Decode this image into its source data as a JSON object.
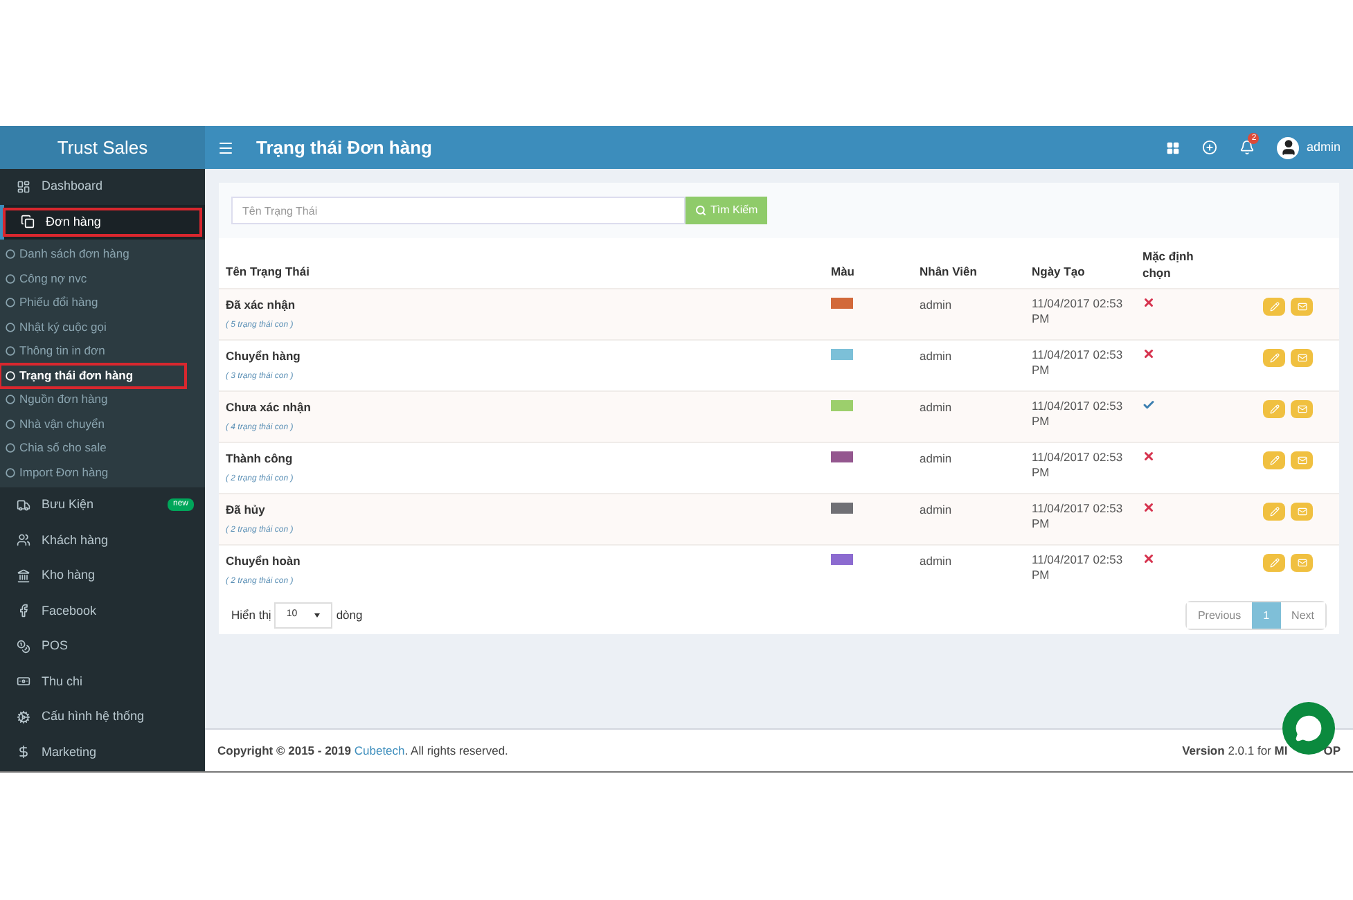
{
  "sidebar": {
    "brand": "Trust Sales",
    "items": [
      {
        "label": "Dashboard",
        "selected": false,
        "highlighted": false
      },
      {
        "label": "Đơn hàng",
        "selected": true,
        "highlighted": true,
        "expanded": true,
        "children": [
          {
            "label": "Danh sách đơn hàng",
            "selected": false,
            "highlighted": false
          },
          {
            "label": "Công nợ nvc",
            "selected": false,
            "highlighted": false
          },
          {
            "label": "Phiếu đổi hàng",
            "selected": false,
            "highlighted": false
          },
          {
            "label": "Nhật ký cuộc gọi",
            "selected": false,
            "highlighted": false
          },
          {
            "label": "Thông tin in đơn",
            "selected": false,
            "highlighted": false
          },
          {
            "label": "Trạng thái đơn hàng",
            "selected": true,
            "highlighted": true
          },
          {
            "label": "Nguồn đơn hàng",
            "selected": false,
            "highlighted": false
          },
          {
            "label": "Nhà vận chuyển",
            "selected": false,
            "highlighted": false
          },
          {
            "label": "Chia số cho sale",
            "selected": false,
            "highlighted": false
          },
          {
            "label": "Import Đơn hàng",
            "selected": false,
            "highlighted": false
          }
        ]
      },
      {
        "label": "Bưu Kiện",
        "selected": false,
        "highlighted": false,
        "badge": "new"
      },
      {
        "label": "Khách hàng",
        "selected": false,
        "highlighted": false
      },
      {
        "label": "Kho hàng",
        "selected": false,
        "highlighted": false
      },
      {
        "label": "Facebook",
        "selected": false,
        "highlighted": false
      },
      {
        "label": "POS",
        "selected": false,
        "highlighted": false
      },
      {
        "label": "Thu chi",
        "selected": false,
        "highlighted": false
      },
      {
        "label": "Cấu hình hệ thống",
        "selected": false,
        "highlighted": false
      },
      {
        "label": "Marketing",
        "selected": false,
        "highlighted": false
      }
    ]
  },
  "header": {
    "title": "Trạng thái Đơn hàng",
    "notification_count": "2",
    "user": "admin"
  },
  "search": {
    "placeholder": "Tên Trạng Thái",
    "button": "Tìm Kiếm"
  },
  "table": {
    "columns": [
      "Tên Trạng Thái",
      "Màu",
      "Nhân Viên",
      "Ngày Tạo",
      "Mặc định chọn"
    ],
    "rows": [
      {
        "name": "Đã xác nhận",
        "sub": "( 5 trạng thái con )",
        "color": "#d2693a",
        "staff": "admin",
        "created": "11/04/2017 02:53 PM",
        "default": false
      },
      {
        "name": "Chuyển hàng",
        "sub": "( 3 trạng thái con )",
        "color": "#7cc0d8",
        "staff": "admin",
        "created": "11/04/2017 02:53 PM",
        "default": false
      },
      {
        "name": "Chưa xác nhận",
        "sub": "( 4 trạng thái con )",
        "color": "#9ccf6c",
        "staff": "admin",
        "created": "11/04/2017 02:53 PM",
        "default": true
      },
      {
        "name": "Thành công",
        "sub": "( 2 trạng thái con )",
        "color": "#94578f",
        "staff": "admin",
        "created": "11/04/2017 02:53 PM",
        "default": false
      },
      {
        "name": "Đã hủy",
        "sub": "( 2 trạng thái con )",
        "color": "#707075",
        "staff": "admin",
        "created": "11/04/2017 02:53 PM",
        "default": false
      },
      {
        "name": "Chuyển hoàn",
        "sub": "( 2 trạng thái con )",
        "color": "#8c6bd0",
        "staff": "admin",
        "created": "11/04/2017 02:53 PM",
        "default": false
      }
    ]
  },
  "page_size": {
    "before": "Hiển thị",
    "value": "10",
    "after": "dòng"
  },
  "pagination": [
    {
      "label": "Previous",
      "selected": false
    },
    {
      "label": "1",
      "selected": true
    },
    {
      "label": "Next",
      "selected": false
    }
  ],
  "footer": {
    "copyright": "Copyright © 2015 - 2019",
    "company": "Cubetech",
    "rights": ". All rights reserved.",
    "version_label": "Version",
    "version": "2.0.1 for",
    "product_start": "MI",
    "product_end": "OP"
  }
}
